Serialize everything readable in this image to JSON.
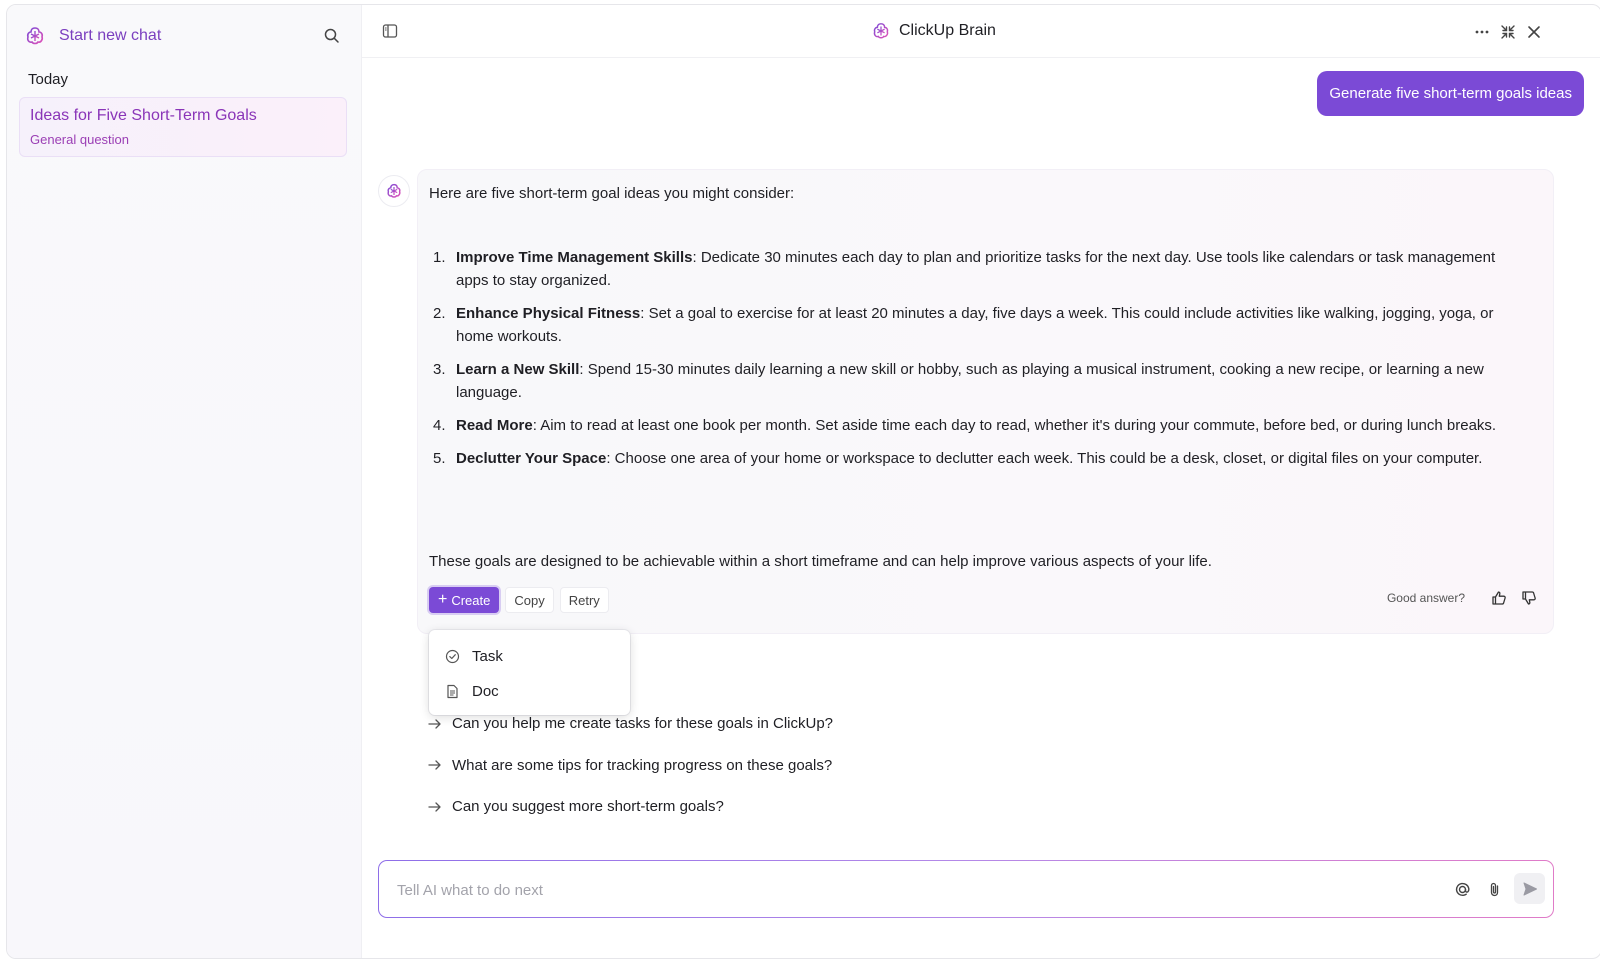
{
  "sidebar": {
    "start_label": "Start new chat",
    "section_label": "Today",
    "chats": [
      {
        "title": "Ideas for Five Short-Term Goals",
        "subtitle": "General question"
      }
    ]
  },
  "header": {
    "title": "ClickUp Brain"
  },
  "user_message": "Generate five short-term goals ideas",
  "answer": {
    "intro": "Here are five short-term goal ideas you might consider:",
    "items": [
      {
        "num": "1.",
        "bold": "Improve Time Management Skills",
        "text": ": Dedicate 30 minutes each day to plan and prioritize tasks for the next day. Use tools like calendars or task management apps to stay organized."
      },
      {
        "num": "2.",
        "bold": "Enhance Physical Fitness",
        "text": ": Set a goal to exercise for at least 20 minutes a day, five days a week. This could include activities like walking, jogging, yoga, or home workouts."
      },
      {
        "num": "3.",
        "bold": "Learn a New Skill",
        "text": ": Spend 15-30 minutes daily learning a new skill or hobby, such as playing a musical instrument, cooking a new recipe, or learning a new language."
      },
      {
        "num": "4.",
        "bold": "Read More",
        "text": ": Aim to read at least one book per month. Set aside time each day to read, whether it's during your commute, before bed, or during lunch breaks."
      },
      {
        "num": "5.",
        "bold": "Declutter Your Space",
        "text": ": Choose one area of your home or workspace to declutter each week. This could be a desk, closet, or digital files on your computer."
      }
    ],
    "outro": "These goals are designed to be achievable within a short timeframe and can help improve various aspects of your life."
  },
  "actions": {
    "create_label": "Create",
    "copy_label": "Copy",
    "retry_label": "Retry",
    "feedback_label": "Good answer?"
  },
  "create_menu": [
    {
      "label": "Task",
      "icon": "check-circle-icon"
    },
    {
      "label": "Doc",
      "icon": "document-icon"
    }
  ],
  "suggestions": [
    "Can you help me create tasks for these goals in ClickUp?",
    "What are some tips for tracking progress on these goals?",
    "Can you suggest more short-term goals?"
  ],
  "composer": {
    "placeholder": "Tell AI what to do next"
  },
  "colors": {
    "accent": "#7b4ad6",
    "sidebar_accent": "#8a35b8"
  }
}
